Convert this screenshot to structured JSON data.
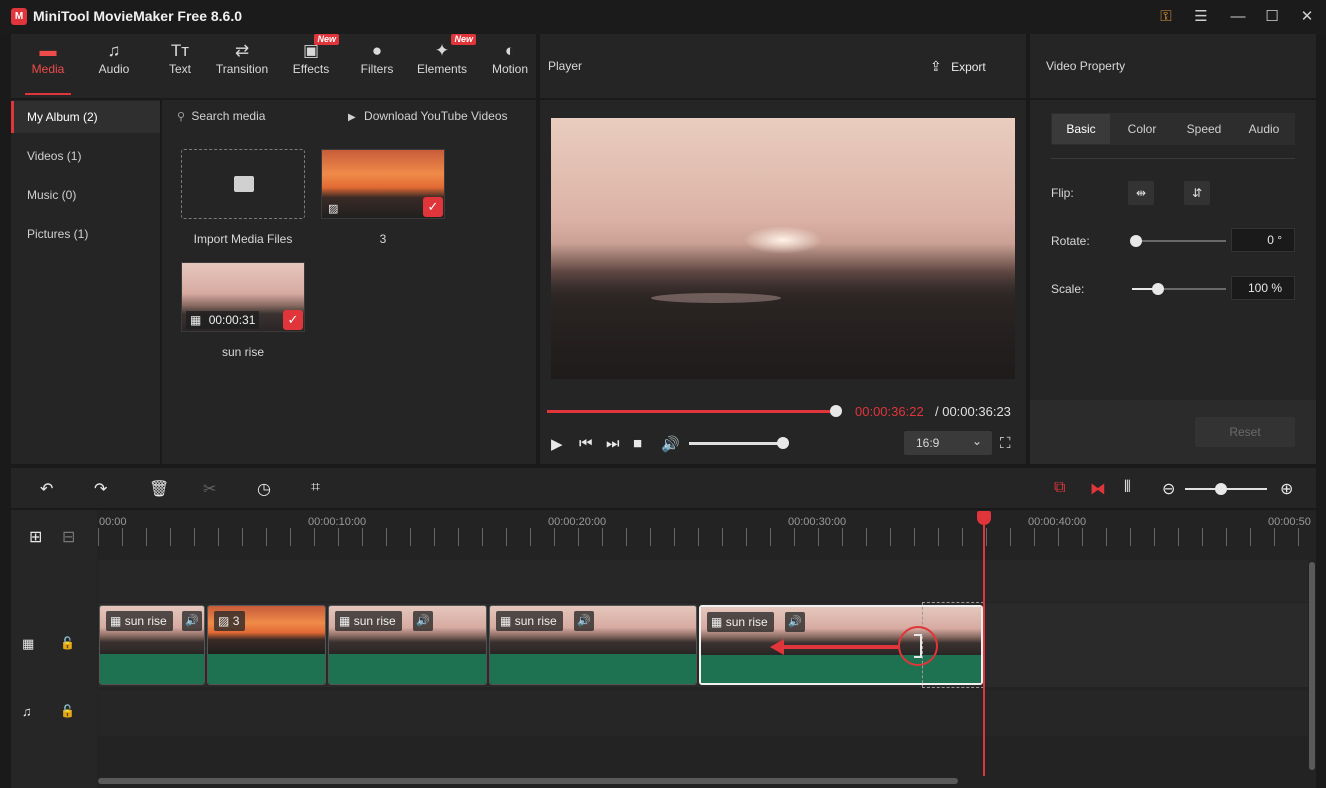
{
  "window": {
    "title": "MiniTool MovieMaker Free 8.6.0"
  },
  "toolbar": {
    "tools": [
      {
        "label": "Media",
        "icon": "folder-icon"
      },
      {
        "label": "Audio",
        "icon": "music-note-icon"
      },
      {
        "label": "Text",
        "icon": "text-icon"
      },
      {
        "label": "Transition",
        "icon": "swap-arrows-icon"
      },
      {
        "label": "Effects",
        "icon": "effects-icon",
        "badge": "New"
      },
      {
        "label": "Filters",
        "icon": "filters-icon"
      },
      {
        "label": "Elements",
        "icon": "elements-icon",
        "badge": "New"
      },
      {
        "label": "Motion",
        "icon": "motion-icon"
      }
    ]
  },
  "sidebar": {
    "items": [
      {
        "label": "My Album (2)"
      },
      {
        "label": "Videos (1)"
      },
      {
        "label": "Music (0)"
      },
      {
        "label": "Pictures (1)"
      }
    ]
  },
  "media": {
    "search_placeholder": "Search media",
    "download_label": "Download YouTube Videos",
    "import_label": "Import Media Files",
    "items": [
      {
        "name": "3",
        "kind": "image"
      },
      {
        "name": "sun rise",
        "kind": "video",
        "duration": "00:00:31"
      }
    ]
  },
  "player": {
    "title": "Player",
    "export_label": "Export",
    "current_time": "00:00:36:22",
    "total_time": "/ 00:00:36:23",
    "progress": 1.0,
    "volume": 0.8,
    "aspect_ratio": "16:9"
  },
  "property": {
    "title": "Video Property",
    "tabs": [
      "Basic",
      "Color",
      "Speed",
      "Audio"
    ],
    "flip_label": "Flip:",
    "rotate_label": "Rotate:",
    "rotate_value": "0 °",
    "scale_label": "Scale:",
    "scale_value": "100 %",
    "reset_label": "Reset"
  },
  "timeline": {
    "ruler": [
      "00:00",
      "00:00:10:00",
      "00:00:20:00",
      "00:00:30:00",
      "00:00:40:00",
      "00:00:50"
    ],
    "clips": [
      {
        "label": "sun rise",
        "kind": "video"
      },
      {
        "label": "3",
        "kind": "image"
      },
      {
        "label": "sun rise",
        "kind": "video"
      },
      {
        "label": "sun rise",
        "kind": "video"
      },
      {
        "label": "sun rise",
        "kind": "video"
      }
    ]
  },
  "colors": {
    "accent": "#e0353a",
    "audio_track": "#1e7151",
    "panel": "#252525"
  }
}
